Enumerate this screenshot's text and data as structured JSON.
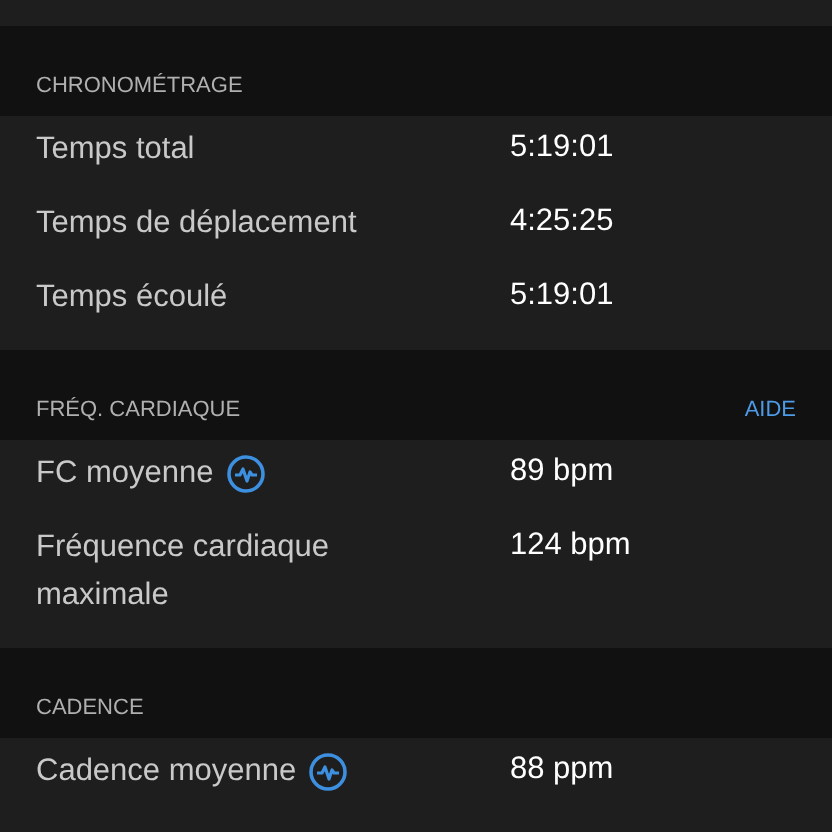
{
  "sections": [
    {
      "title": "CHRONOMÉTRAGE",
      "rows": [
        {
          "label": "Temps total",
          "value": "5:19:01",
          "info_icon": false
        },
        {
          "label": "Temps de déplacement",
          "value": "4:25:25",
          "info_icon": false
        },
        {
          "label": "Temps écoulé",
          "value": "5:19:01",
          "info_icon": false
        }
      ]
    },
    {
      "title": "FRÉQ. CARDIAQUE",
      "link": "AIDE",
      "rows": [
        {
          "label": "FC moyenne",
          "value": "89 bpm",
          "info_icon": true
        },
        {
          "label": "Fréquence cardiaque maximale",
          "value": "124 bpm",
          "info_icon": false
        }
      ]
    },
    {
      "title": "CADENCE",
      "rows": [
        {
          "label": "Cadence moyenne",
          "value": "88 ppm",
          "info_icon": true
        }
      ]
    }
  ]
}
